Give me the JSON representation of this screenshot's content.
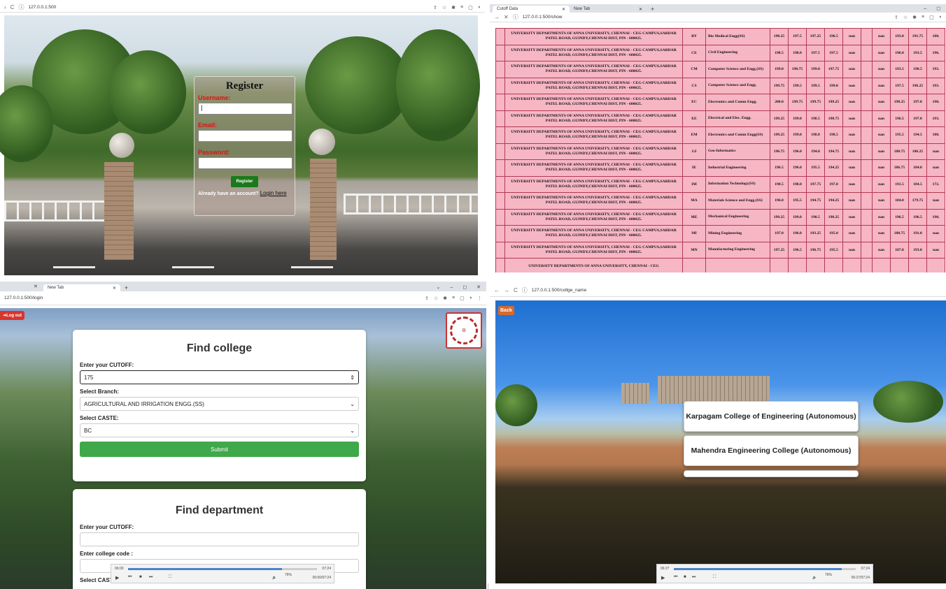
{
  "q1": {
    "url": "127.0.0.1:500",
    "register": {
      "title": "Register",
      "username_label": "Username:",
      "email_label": "Email:",
      "password_label": "Password:",
      "button": "Register",
      "footer_text": "Already have an account?",
      "login_link": "Login here"
    }
  },
  "q2": {
    "tabs": [
      "Cutoff Data",
      "New Tab"
    ],
    "url": "127.0.0.1:500/show",
    "rows": [
      {
        "inst": "UNIVERSITY DEPARTMENTS OF ANNA UNIVERSITY, CHENNAI - CEG CAMPUS,SARDAR PATEL ROAD, GUINDY,CHENNAI DIST, PIN - 600025.",
        "code": "BY",
        "branch": "Bio Medical Engg(SS)",
        "v": [
          "198.25",
          "197.5",
          "197.25",
          "196.5",
          "nan",
          "nan",
          "193.0",
          "191.75",
          "188."
        ]
      },
      {
        "inst": "UNIVERSITY DEPARTMENTS OF ANNA UNIVERSITY, CHENNAI - CEG CAMPUS,SARDAR PATEL ROAD, GUINDY,CHENNAI DIST, PIN - 600025.",
        "code": "CE",
        "branch": "Civil Engineering",
        "v": [
          "198.5",
          "198.0",
          "197.5",
          "197.5",
          "nan",
          "nan",
          "196.0",
          "193.5",
          "196."
        ]
      },
      {
        "inst": "UNIVERSITY DEPARTMENTS OF ANNA UNIVERSITY, CHENNAI - CEG CAMPUS,SARDAR PATEL ROAD, GUINDY,CHENNAI DIST, PIN - 600025.",
        "code": "CM",
        "branch": "Computer Science and Engg.(SS)",
        "v": [
          "199.0",
          "198.75",
          "199.0",
          "197.75",
          "nan",
          "nan",
          "193.5",
          "190.5",
          "193."
        ]
      },
      {
        "inst": "UNIVERSITY DEPARTMENTS OF ANNA UNIVERSITY, CHENNAI - CEG CAMPUS,SARDAR PATEL ROAD, GUINDY,CHENNAI DIST, PIN - 600025.",
        "code": "CS",
        "branch": "Computer Science and Engg.",
        "v": [
          "199.75",
          "199.5",
          "199.5",
          "199.0",
          "nan",
          "nan",
          "197.5",
          "196.25",
          "193."
        ]
      },
      {
        "inst": "UNIVERSITY DEPARTMENTS OF ANNA UNIVERSITY, CHENNAI - CEG CAMPUS,SARDAR PATEL ROAD, GUINDY,CHENNAI DIST, PIN - 600025.",
        "code": "EC",
        "branch": "Electronics and Comm Engg.",
        "v": [
          "200.0",
          "199.75",
          "199.75",
          "199.25",
          "nan",
          "nan",
          "198.25",
          "197.0",
          "190."
        ]
      },
      {
        "inst": "UNIVERSITY DEPARTMENTS OF ANNA UNIVERSITY, CHENNAI - CEG CAMPUS,SARDAR PATEL ROAD, GUINDY,CHENNAI DIST, PIN - 600025.",
        "code": "EE",
        "branch": "Electrical and Elec. Engg.",
        "v": [
          "199.25",
          "199.0",
          "198.5",
          "198.75",
          "nan",
          "nan",
          "196.5",
          "197.0",
          "193."
        ]
      },
      {
        "inst": "UNIVERSITY DEPARTMENTS OF ANNA UNIVERSITY, CHENNAI - CEG CAMPUS,SARDAR PATEL ROAD, GUINDY,CHENNAI DIST, PIN - 600025.",
        "code": "EM",
        "branch": "Electronics and Comm Engg(SS)",
        "v": [
          "199.25",
          "199.0",
          "198.0",
          "198.5",
          "nan",
          "nan",
          "195.5",
          "194.5",
          "188."
        ]
      },
      {
        "inst": "UNIVERSITY DEPARTMENTS OF ANNA UNIVERSITY, CHENNAI - CEG CAMPUS,SARDAR PATEL ROAD, GUINDY,CHENNAI DIST, PIN - 600025.",
        "code": "GI",
        "branch": "Geo-Informatics",
        "v": [
          "196.75",
          "196.0",
          "194.0",
          "194.75",
          "nan",
          "nan",
          "188.75",
          "186.25",
          "nan"
        ]
      },
      {
        "inst": "UNIVERSITY DEPARTMENTS OF ANNA UNIVERSITY, CHENNAI - CEG CAMPUS,SARDAR PATEL ROAD, GUINDY,CHENNAI DIST, PIN - 600025.",
        "code": "IE",
        "branch": "Industrial Engineering",
        "v": [
          "196.5",
          "196.0",
          "195.5",
          "194.25",
          "nan",
          "nan",
          "186.75",
          "184.0",
          "nan"
        ]
      },
      {
        "inst": "UNIVERSITY DEPARTMENTS OF ANNA UNIVERSITY, CHENNAI - CEG CAMPUS,SARDAR PATEL ROAD, GUINDY,CHENNAI DIST, PIN - 600025.",
        "code": "IM",
        "branch": "Information Technology(SS)",
        "v": [
          "198.5",
          "198.0",
          "197.75",
          "197.0",
          "nan",
          "nan",
          "191.5",
          "184.5",
          "172."
        ]
      },
      {
        "inst": "UNIVERSITY DEPARTMENTS OF ANNA UNIVERSITY, CHENNAI - CEG CAMPUS,SARDAR PATEL ROAD, GUINDY,CHENNAI DIST, PIN - 600025.",
        "code": "MA",
        "branch": "Materials Science and Engg.(SS)",
        "v": [
          "196.0",
          "195.5",
          "194.75",
          "194.25",
          "nan",
          "nan",
          "184.0",
          "179.75",
          "nan"
        ]
      },
      {
        "inst": "UNIVERSITY DEPARTMENTS OF ANNA UNIVERSITY, CHENNAI - CEG CAMPUS,SARDAR PATEL ROAD, GUINDY,CHENNAI DIST, PIN - 600025.",
        "code": "ME",
        "branch": "Mechanical Engineering",
        "v": [
          "199.25",
          "199.0",
          "198.5",
          "198.25",
          "nan",
          "nan",
          "196.5",
          "196.5",
          "190."
        ]
      },
      {
        "inst": "UNIVERSITY DEPARTMENTS OF ANNA UNIVERSITY, CHENNAI - CEG CAMPUS,SARDAR PATEL ROAD, GUINDY,CHENNAI DIST, PIN - 600025.",
        "code": "MI",
        "branch": "Mining Engineering",
        "v": [
          "197.0",
          "196.0",
          "193.25",
          "195.0",
          "nan",
          "nan",
          "188.75",
          "191.0",
          "nan"
        ]
      },
      {
        "inst": "UNIVERSITY DEPARTMENTS OF ANNA UNIVERSITY, CHENNAI - CEG CAMPUS,SARDAR PATEL ROAD, GUINDY,CHENNAI DIST, PIN - 600025.",
        "code": "MN",
        "branch": "Manufacturing Engineering",
        "v": [
          "197.25",
          "196.5",
          "196.75",
          "195.5",
          "nan",
          "nan",
          "187.0",
          "193.0",
          "nan"
        ]
      },
      {
        "inst": "UNIVERSITY DEPARTMENTS OF ANNA UNIVERSITY, CHENNAI - CEG",
        "code": "",
        "branch": "",
        "v": [
          "",
          "",
          "",
          "",
          "",
          "",
          "",
          "",
          ""
        ]
      }
    ]
  },
  "q3": {
    "tabs": [
      "New Tab"
    ],
    "url": "127.0.0.1:500/login",
    "logout": "Log out",
    "find_college": {
      "title": "Find college",
      "cutoff_label": "Enter your CUTOFF:",
      "cutoff_value": "175",
      "branch_label": "Select Branch:",
      "branch_value": "AGRICULTURAL AND IRRIGATION ENGG.(SS)",
      "caste_label": "Select CASTE:",
      "caste_value": "BC",
      "submit": "Submit"
    },
    "find_department": {
      "title": "Find department",
      "cutoff_label": "Enter your CUTOFF:",
      "college_code_label": "Enter college code :",
      "caste_label_partial": "Select CAST"
    },
    "player": {
      "time_start": "06:00",
      "time_end": "07:24",
      "time_combined": "00:00/07:24",
      "zoom": "76%"
    }
  },
  "q4": {
    "url": "127.0.0.1:500/collge_name",
    "back": "Back",
    "colleges": [
      "Karpagam College of Engineering (Autonomous)",
      "Mahendra Engineering College (Autonomous)",
      ""
    ],
    "player": {
      "time_start": "06:27",
      "time_end": "07:24",
      "time_combined": "06:27/07:24",
      "zoom": "76%"
    }
  }
}
